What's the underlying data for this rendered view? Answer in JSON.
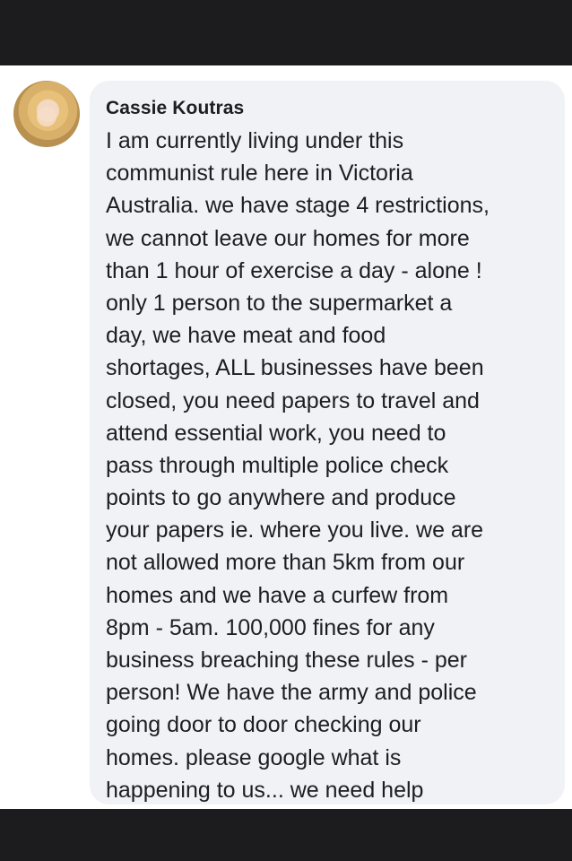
{
  "comment": {
    "author": "Cassie Koutras",
    "lines": [
      "I  am currently living under this",
      "communist rule here in Victoria",
      "Australia. we have stage 4 restrictions,",
      "we cannot leave our homes for more",
      "than 1 hour of exercise a day - alone !",
      "only 1 person to the supermarket a",
      "day, we have meat and food",
      "shortages, ALL businesses have been",
      "closed, you need papers to travel and",
      "attend essential work, you need to",
      "pass through multiple police check",
      "points to go anywhere and produce",
      "your papers ie. where you live. we are",
      "not allowed more than 5km from our",
      "homes and we have a curfew from",
      "8pm - 5am. 100,000 fines for any",
      "business breaching these rules - per",
      "person! We have the army and police",
      "going door to door checking our",
      "homes. please google what is",
      "happening to us... we need help"
    ]
  }
}
